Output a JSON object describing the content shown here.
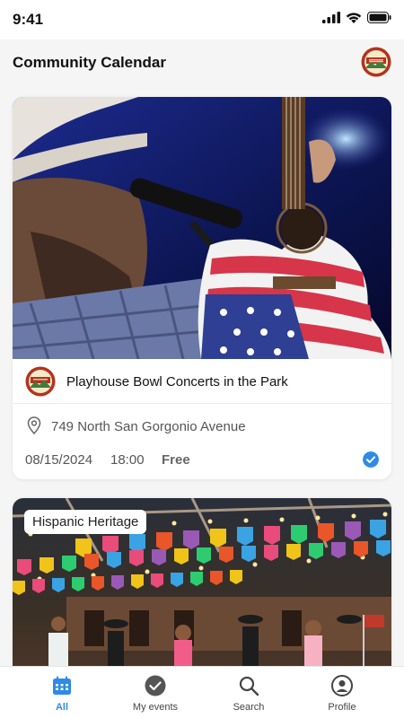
{
  "status_bar": {
    "time": "9:41"
  },
  "header": {
    "title": "Community Calendar",
    "logo_icon": "banning-city-seal"
  },
  "events": [
    {
      "image": "concert-guitarist-photo",
      "title": "Playhouse Bowl Concerts in the Park",
      "address": "749 North San Gorgonio Avenue",
      "date": "08/15/2024",
      "time": "18:00",
      "price": "Free",
      "saved": true
    },
    {
      "image": "folklorico-dancers-photo",
      "category": "Hispanic Heritage"
    }
  ],
  "tab_bar": {
    "active": "All",
    "tabs": [
      {
        "label": "All",
        "icon": "calendar-icon"
      },
      {
        "label": "My events",
        "icon": "check-circle-icon"
      },
      {
        "label": "Search",
        "icon": "search-icon"
      },
      {
        "label": "Profile",
        "icon": "profile-icon"
      }
    ]
  },
  "colors": {
    "accent": "#2f8ae6",
    "background": "#f5f5f5",
    "card": "#ffffff"
  }
}
